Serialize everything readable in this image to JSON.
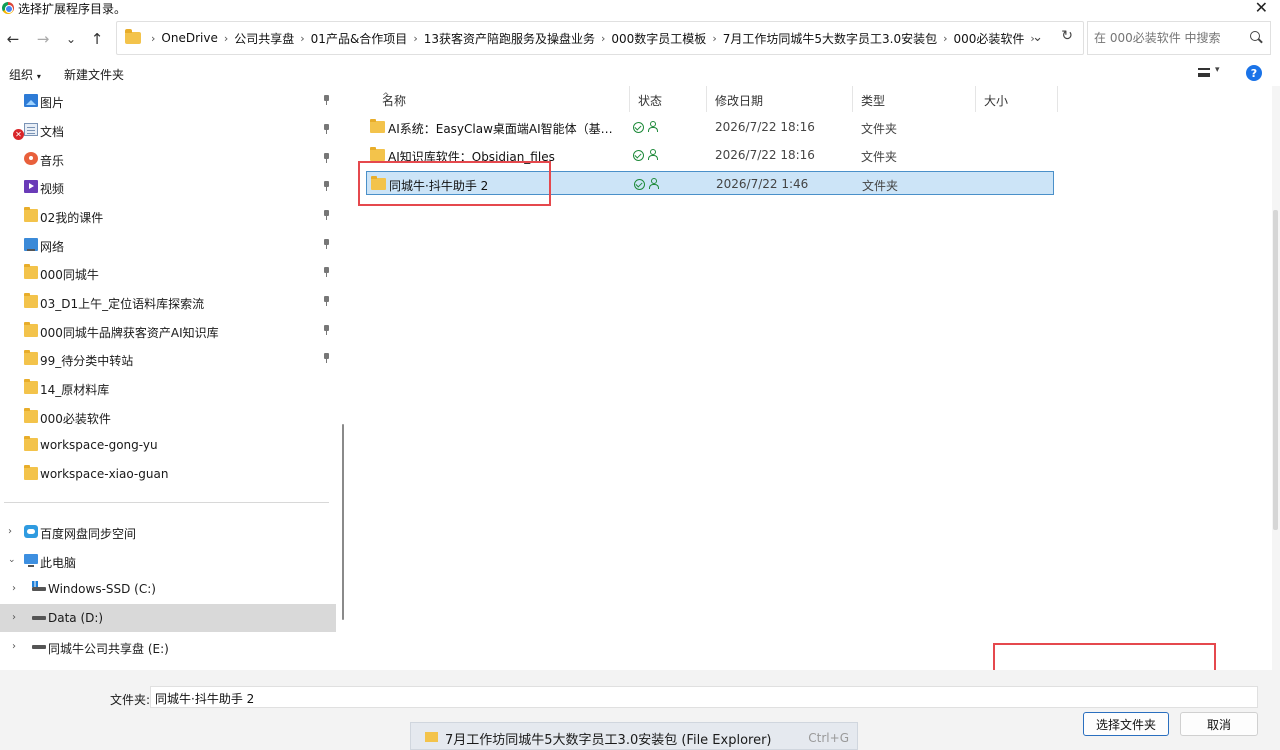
{
  "window": {
    "title": "选择扩展程序目录。"
  },
  "nav": {
    "back": "←",
    "forward": "→",
    "recent": "⌄",
    "up": "↑",
    "breadcrumb": [
      "OneDrive",
      "公司共享盘",
      "01产品&合作项目",
      "13获客资产陪跑服务及操盘业务",
      "000数字员工模板",
      "7月工作坊同城牛5大数字员工3.0安装包",
      "000必装软件"
    ],
    "search_placeholder": "在 000必装软件 中搜索"
  },
  "toolbar": {
    "organize": "组织",
    "new_folder": "新建文件夹"
  },
  "sidebar": {
    "quick_access": [
      {
        "label": "图片",
        "icon": "pictures-icon"
      },
      {
        "label": "文档",
        "icon": "documents-icon"
      },
      {
        "label": "音乐",
        "icon": "music-icon"
      },
      {
        "label": "视频",
        "icon": "videos-icon"
      },
      {
        "label": "02我的课件",
        "icon": "folder-icon"
      },
      {
        "label": "网络",
        "icon": "network-icon"
      },
      {
        "label": "000同城牛",
        "icon": "folder-icon"
      },
      {
        "label": "03_D1上午_定位语料库探索流",
        "icon": "folder-icon"
      },
      {
        "label": "000同城牛品牌获客资产AI知识库",
        "icon": "folder-icon"
      },
      {
        "label": "99_待分类中转站",
        "icon": "folder-icon"
      },
      {
        "label": "14_原材料库",
        "icon": "folder-icon"
      },
      {
        "label": "000必装软件",
        "icon": "folder-icon"
      },
      {
        "label": "workspace-gong-yu",
        "icon": "folder-icon"
      },
      {
        "label": "workspace-xiao-guan",
        "icon": "folder-icon"
      }
    ],
    "locations": [
      {
        "label": "百度网盘同步空间",
        "icon": "cloud-icon"
      },
      {
        "label": "此电脑",
        "icon": "pc-icon"
      },
      {
        "label": "Windows-SSD (C:)",
        "icon": "windows-drive-icon"
      },
      {
        "label": "Data (D:)",
        "icon": "drive-icon"
      },
      {
        "label": "同城牛公司共享盘 (E:)",
        "icon": "drive-icon"
      }
    ]
  },
  "columns": {
    "name": "名称",
    "status": "状态",
    "modified": "修改日期",
    "type": "类型",
    "size": "大小"
  },
  "files": [
    {
      "name": "AI系统：EasyClaw桌面端AI智能体（基于Ope...",
      "date": "2026/7/22 18:16",
      "type": "文件夹"
    },
    {
      "name": "AI知识库软件：Obsidian_files",
      "date": "2026/7/22 18:16",
      "type": "文件夹"
    },
    {
      "name": "同城牛·抖牛助手 2",
      "date": "2026/7/22 1:46",
      "type": "文件夹"
    }
  ],
  "bottom": {
    "filename_label": "文件夹:",
    "filename_value": "同城牛·抖牛助手 2",
    "select_button": "选择文件夹",
    "cancel_button": "取消"
  },
  "tooltip": {
    "text": "7月工作坊同城牛5大数字员工3.0安装包 (File Explorer)",
    "shortcut": "Ctrl+G"
  },
  "colors": {
    "selection": "#cce4f7",
    "annotation": "#e5484d",
    "folder": "#f3c34b"
  }
}
